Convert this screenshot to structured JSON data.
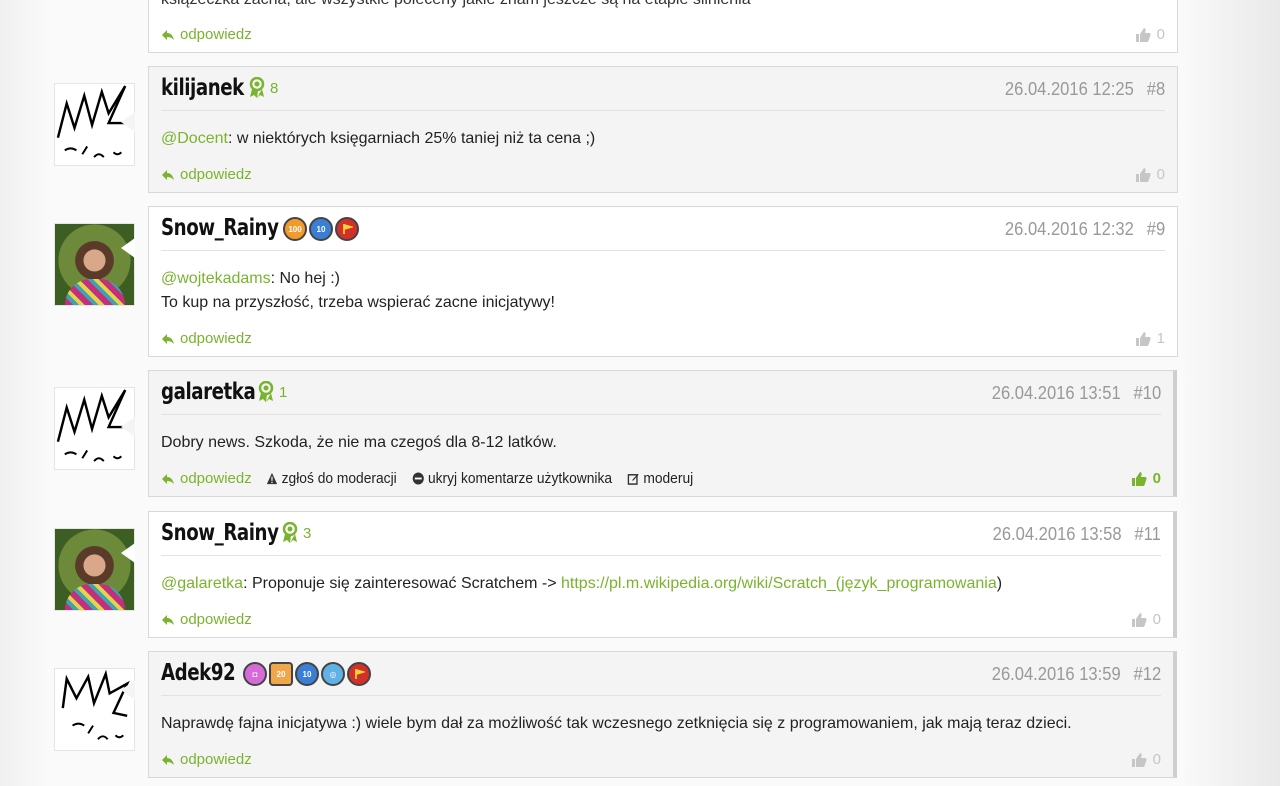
{
  "top_partial": {
    "text": "książeczka zacna, ale wszystkie poleceny jakie znam jeszcze są na etapie silnienia",
    "reply_label": "odpowiedz",
    "likes": "0"
  },
  "comments": [
    {
      "username": "kilijanek",
      "rank": "8",
      "date": "26.04.2016 12:25",
      "number": "#8",
      "mention": "@Docent",
      "text": ": w niektórych księgarniach 25% taniej niż ta cena ;)",
      "reply_label": "odpowiedz",
      "likes": "0"
    },
    {
      "username": "Snow_Rainy",
      "badges": [
        "100",
        "10",
        "flag"
      ],
      "date": "26.04.2016 12:32",
      "number": "#9",
      "mention": "@wojtekadams",
      "text": ": No hej :)",
      "text2": "To kup na przyszłość, trzeba wspierać zacne inicjatywy!",
      "reply_label": "odpowiedz",
      "likes": "1"
    },
    {
      "username": "galaretka",
      "rank": "1",
      "date": "26.04.2016 13:51",
      "number": "#10",
      "text": "Dobry news. Szkoda, że nie ma czegoś dla 8-12 latków.",
      "reply_label": "odpowiedz",
      "report_label": "zgłoś do moderacji",
      "hide_label": "ukryj komentarze użytkownika",
      "moderate_label": "moderuj",
      "likes": "0"
    },
    {
      "username": "Snow_Rainy",
      "rank": "3",
      "date": "26.04.2016 13:58",
      "number": "#11",
      "mention": "@galaretka",
      "text": ": Proponuje się zainteresować Scratchem -> ",
      "link": "https://pl.m.wikipedia.org/wiki/Scratch_(język_programowania",
      "after_link": ")",
      "reply_label": "odpowiedz",
      "likes": "0"
    },
    {
      "username": "Adek92",
      "badges": [
        "camera",
        "20",
        "10",
        "globe",
        "flag"
      ],
      "date": "26.04.2016 13:59",
      "number": "#12",
      "text": "Naprawdę fajna inicjatywa :) wiele bym dał za możliwość tak wczesnego zetknięcia się z programowaniem, jak mają teraz dzieci.",
      "reply_label": "odpowiedz",
      "likes": "0"
    }
  ],
  "colors": {
    "accent": "#7ab32e",
    "muted": "#999999",
    "border": "#d8d8d8"
  }
}
